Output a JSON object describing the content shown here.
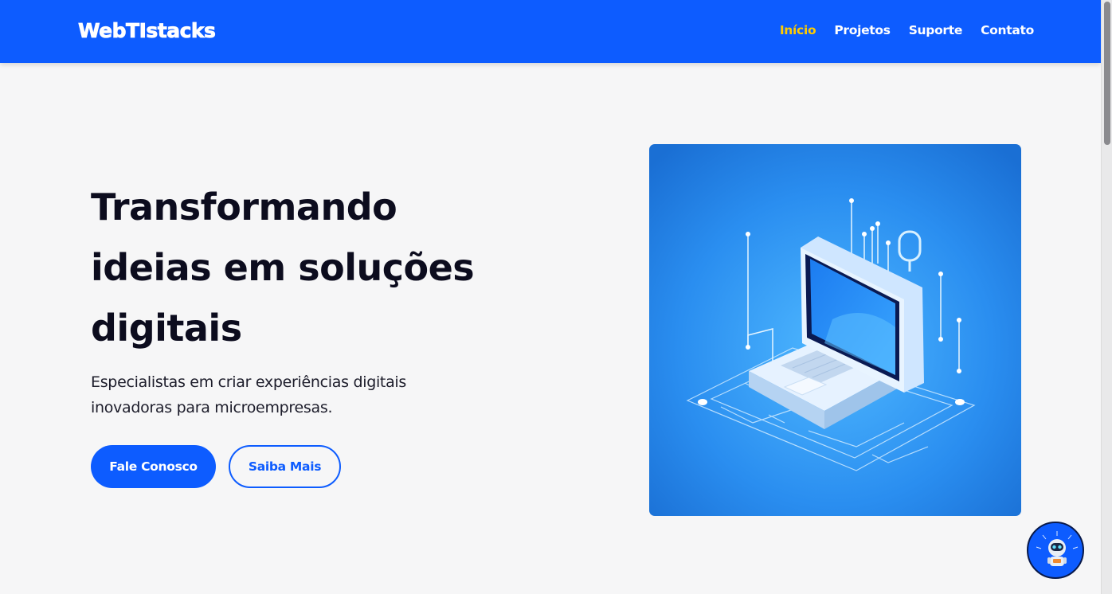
{
  "brand": {
    "logo": "WebTIstacks",
    "primary_color": "#0d5cff",
    "accent_color": "#ffcc00"
  },
  "nav": {
    "items": [
      {
        "label": "Início",
        "active": true
      },
      {
        "label": "Projetos",
        "active": false
      },
      {
        "label": "Suporte",
        "active": false
      },
      {
        "label": "Contato",
        "active": false
      }
    ]
  },
  "hero": {
    "title": "Transformando ideias em soluções digitais",
    "subtitle": "Especialistas em criar experiências digitais inovadoras para microempresas.",
    "primary_button": "Fale Conosco",
    "secondary_button": "Saiba Mais",
    "image_icon": "laptop-circuit-illustration"
  },
  "chat": {
    "icon": "robot-icon"
  }
}
